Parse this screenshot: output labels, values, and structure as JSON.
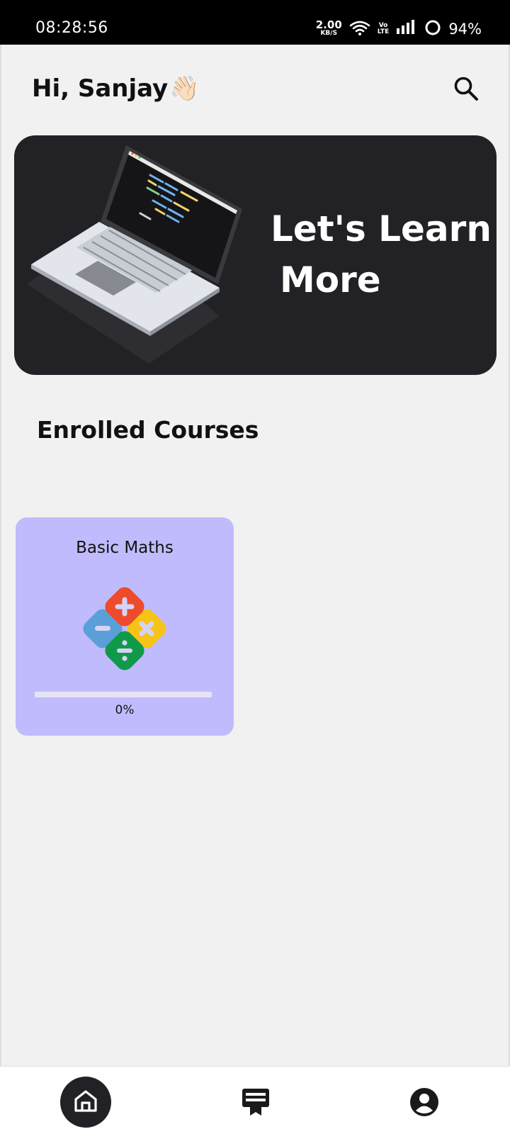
{
  "status_bar": {
    "time": "08:28:56",
    "net_speed": "2.00",
    "net_unit": "KB/S",
    "volte_top": "Vo",
    "volte_bottom": "LTE",
    "battery": "94%",
    "icons": [
      "wifi-icon",
      "signal-icon",
      "battery-icon"
    ]
  },
  "header": {
    "greeting": "Hi, Sanjay",
    "wave_emoji": "👋🏻",
    "search_icon": "search-icon"
  },
  "banner": {
    "line1": "Let's Learn",
    "line2": "More",
    "image": "laptop-illustration",
    "background": "#222226"
  },
  "enrolled": {
    "title": "Enrolled Courses",
    "courses": [
      {
        "title": "Basic Maths",
        "icon": "math-operators-icon",
        "progress": 0,
        "progress_label": "0%",
        "card_color": "#c0bbfc"
      }
    ]
  },
  "bottom_nav": {
    "items": [
      {
        "name": "home",
        "icon": "home-icon",
        "active": true
      },
      {
        "name": "courses",
        "icon": "courses-icon",
        "active": false
      },
      {
        "name": "profile",
        "icon": "profile-icon",
        "active": false
      }
    ]
  }
}
